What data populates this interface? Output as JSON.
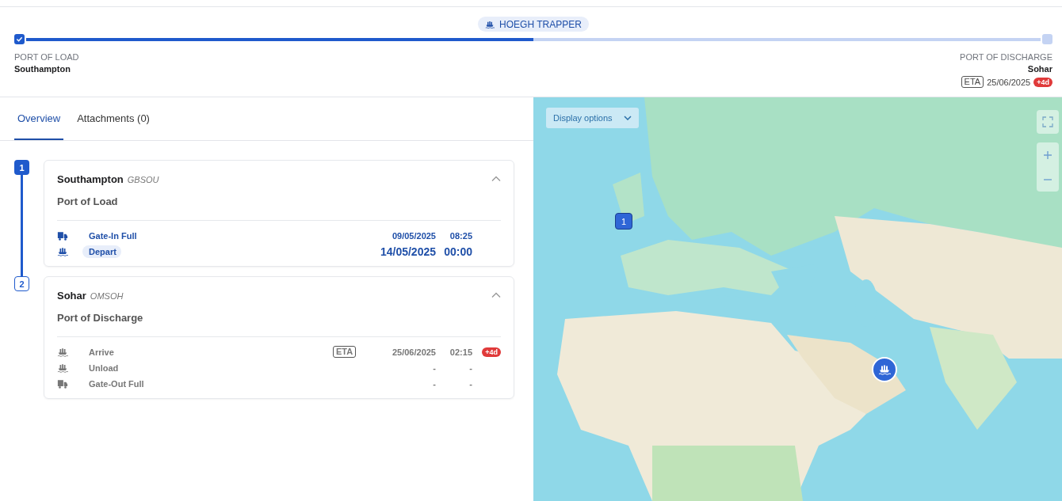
{
  "voyage": {
    "vessel": "HOEGH TRAPPER",
    "level": 0.5,
    "origin_done": true,
    "destination_done": false,
    "origin": {
      "label": "PORT OF LOAD",
      "name": "Southampton"
    },
    "destination": {
      "label": "PORT OF DISCHARGE",
      "name": "Sohar",
      "eta_label": "ETA",
      "date": "25/06/2025",
      "delay": "+4d"
    }
  },
  "tabs": [
    {
      "label": "Overview",
      "selected": true
    },
    {
      "label": "Attachments (0)",
      "selected": false
    }
  ],
  "stops": [
    {
      "number": "1",
      "completed": true,
      "name": "Southampton",
      "code": "GBSOU",
      "role": "Port of Load",
      "expanded": true,
      "events": [
        {
          "kind": "truck",
          "label": "Gate-In Full",
          "completed": true,
          "current": false,
          "date": "09/05/2025",
          "time": "08:25"
        },
        {
          "kind": "ship",
          "label": "Depart",
          "completed": true,
          "current": true,
          "date": "14/05/2025",
          "time": "00:00"
        }
      ]
    },
    {
      "number": "2",
      "completed": false,
      "name": "Sohar",
      "code": "OMSOH",
      "role": "Port of Discharge",
      "expanded": true,
      "events": [
        {
          "kind": "ship",
          "label": "Arrive",
          "completed": false,
          "current": false,
          "eta_label": "ETA",
          "date": "25/06/2025",
          "time": "02:15",
          "delay": "+4d"
        },
        {
          "kind": "ship",
          "label": "Unload",
          "completed": false,
          "current": false,
          "date": "-",
          "time": "-"
        },
        {
          "kind": "truck",
          "label": "Gate-Out Full",
          "completed": false,
          "current": false,
          "date": "-",
          "time": "-"
        }
      ]
    }
  ],
  "map": {
    "display_options": "Display options",
    "markers": [
      {
        "kind": "stop",
        "label": "1"
      },
      {
        "kind": "vessel"
      }
    ]
  }
}
